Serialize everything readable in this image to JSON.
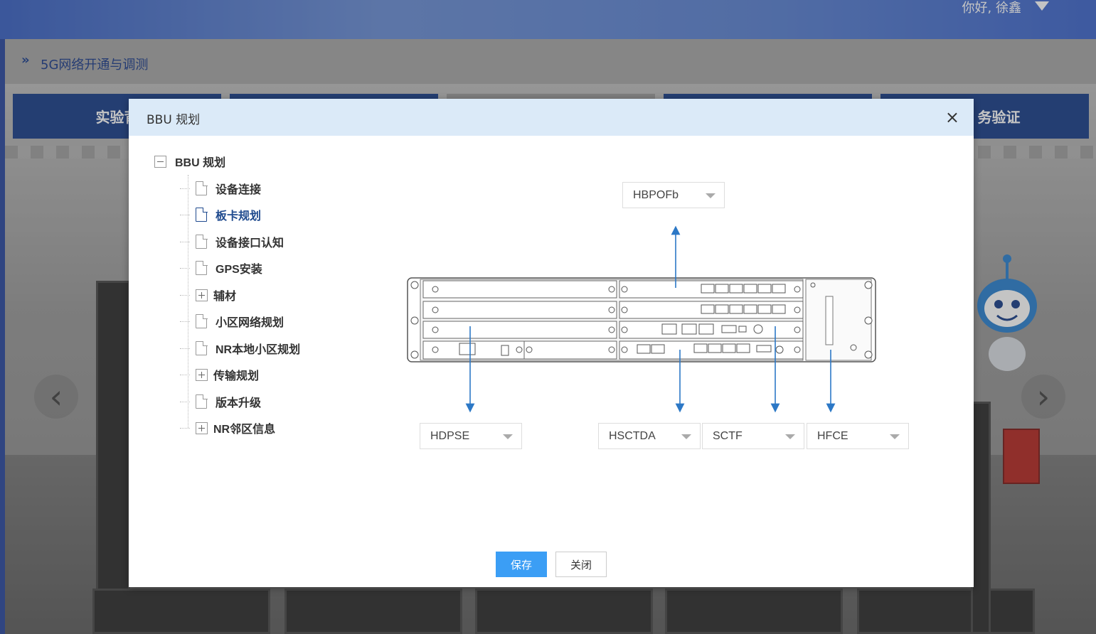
{
  "header": {
    "greeting": "你好, 徐鑫"
  },
  "breadcrumb": {
    "arrows": "»",
    "title": "5G网络开通与调测"
  },
  "tabs": [
    {
      "label": "实验背"
    },
    {
      "label": ""
    },
    {
      "label": ""
    },
    {
      "label": ""
    },
    {
      "label": "务验证"
    }
  ],
  "modal": {
    "title": "BBU 规划",
    "close": "×",
    "tree": {
      "root": "BBU 规划",
      "items": [
        {
          "label": "设备连接",
          "type": "doc"
        },
        {
          "label": "板卡规划",
          "type": "doc",
          "active": true
        },
        {
          "label": "设备接口认知",
          "type": "doc"
        },
        {
          "label": "GPS安装",
          "type": "doc"
        },
        {
          "label": "辅材",
          "type": "folder"
        },
        {
          "label": "小区网络规划",
          "type": "doc"
        },
        {
          "label": "NR本地小区规划",
          "type": "doc"
        },
        {
          "label": "传输规划",
          "type": "folder"
        },
        {
          "label": "版本升级",
          "type": "doc"
        },
        {
          "label": "NR邻区信息",
          "type": "folder"
        }
      ]
    },
    "selects": {
      "top": "HBPOFb",
      "power": "HDPSE",
      "control": "HSCTDA",
      "sctf": "SCTF",
      "fan": "HFCE"
    },
    "buttons": {
      "save": "保存",
      "close": "关闭"
    }
  }
}
